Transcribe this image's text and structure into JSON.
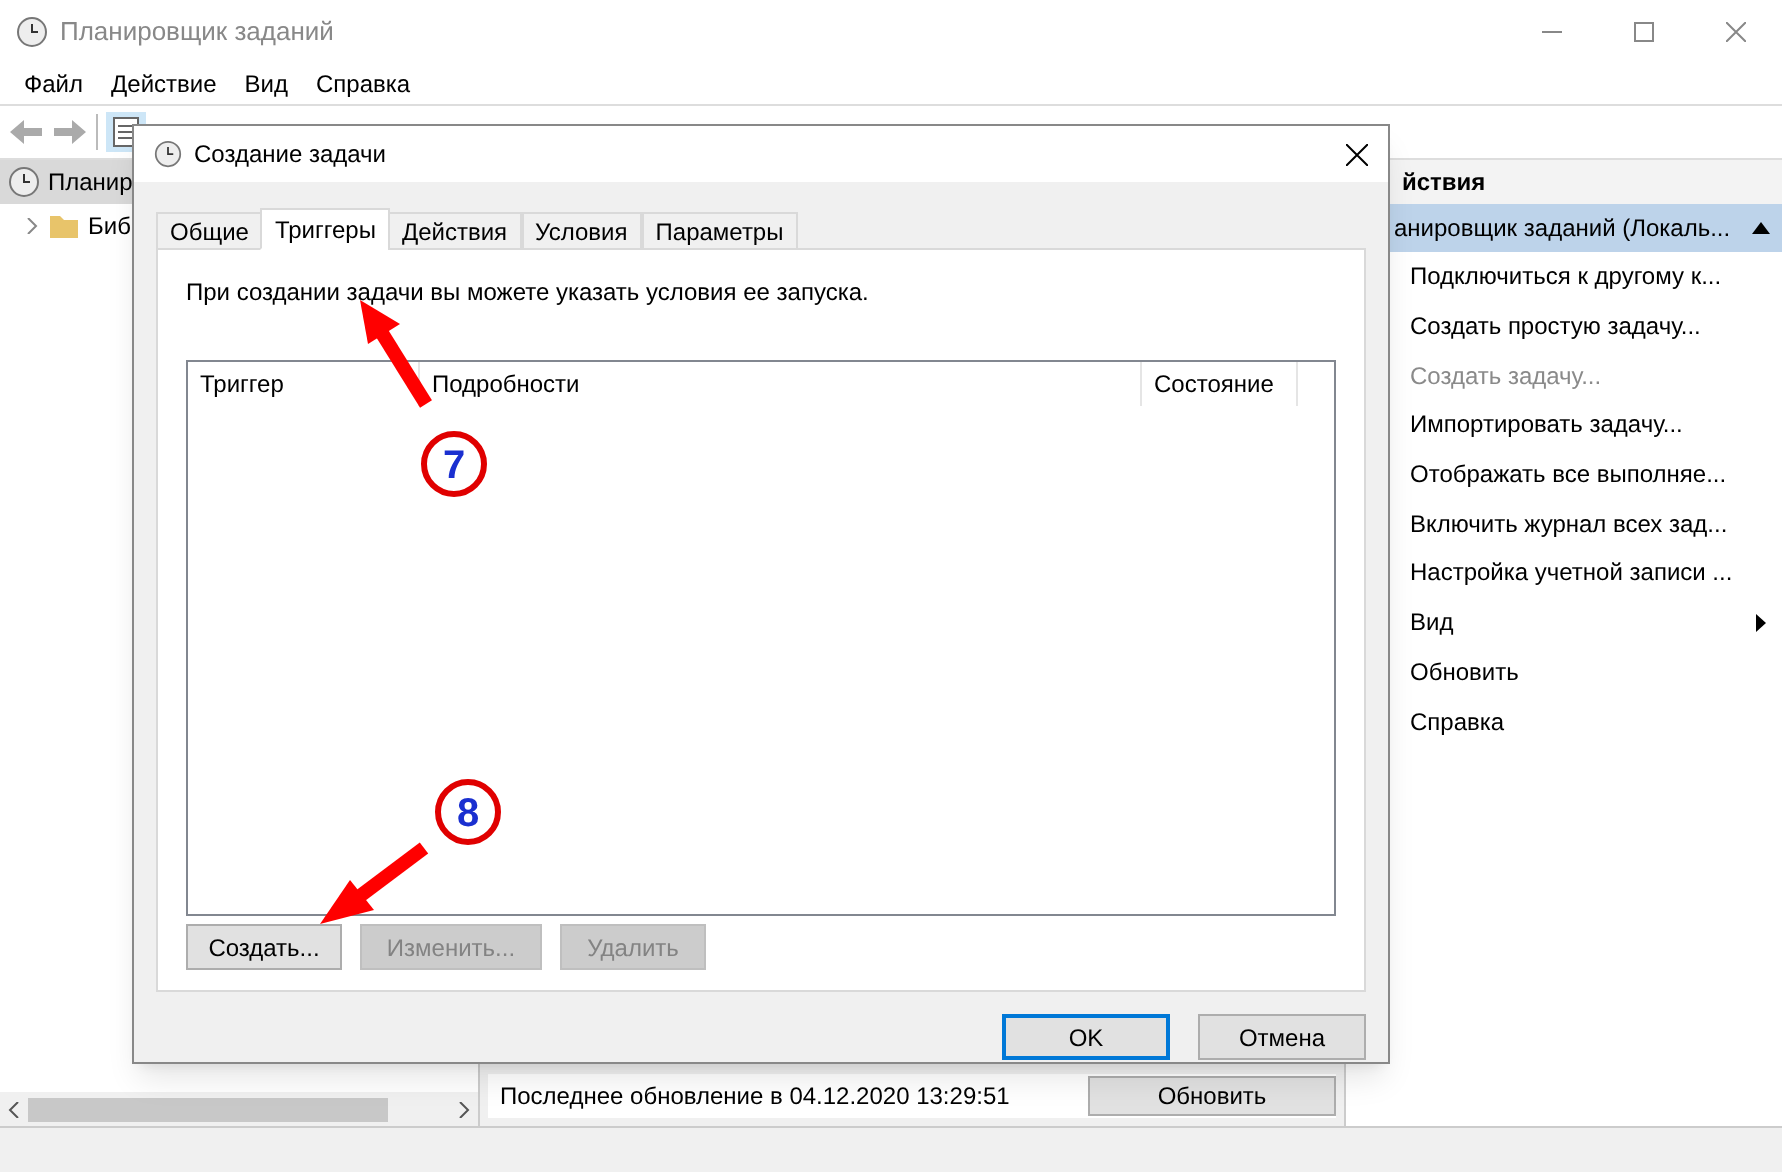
{
  "window": {
    "title": "Планировщик заданий"
  },
  "menu": [
    "Файл",
    "Действие",
    "Вид",
    "Справка"
  ],
  "tree": [
    {
      "label": "Планир",
      "selected": true,
      "children": [
        {
          "label": "Биб",
          "selected": false,
          "expanded": false
        }
      ]
    }
  ],
  "center": {
    "last_update": "Последнее обновление в 04.12.2020 13:29:51",
    "refresh_button": "Обновить"
  },
  "actions_panel": {
    "header": "йствия",
    "group": "анировщик заданий (Локаль...",
    "items": [
      {
        "label": "Подключиться к другому к...",
        "disabled": false,
        "kind": "plain"
      },
      {
        "label": "Создать простую задачу...",
        "disabled": false,
        "kind": "plain"
      },
      {
        "label": "Создать задачу...",
        "disabled": true,
        "kind": "plain"
      },
      {
        "label": "Импортировать задачу...",
        "disabled": false,
        "kind": "plain"
      },
      {
        "label": "Отображать все выполняе...",
        "disabled": false,
        "kind": "plain"
      },
      {
        "label": "Включить журнал всех зад...",
        "disabled": false,
        "kind": "plain"
      },
      {
        "label": "Настройка учетной записи ...",
        "disabled": false,
        "kind": "plain"
      },
      {
        "label": "Вид",
        "disabled": false,
        "kind": "submenu"
      },
      {
        "label": "Обновить",
        "disabled": false,
        "kind": "plain"
      },
      {
        "label": "Справка",
        "disabled": false,
        "kind": "plain"
      }
    ]
  },
  "dialog": {
    "title": "Создание задачи",
    "tabs": [
      {
        "label": "Общие",
        "selected": false
      },
      {
        "label": "Триггеры",
        "selected": true
      },
      {
        "label": "Действия",
        "selected": false
      },
      {
        "label": "Условия",
        "selected": false
      },
      {
        "label": "Параметры",
        "selected": false
      }
    ],
    "description": "При создании задачи вы можете указать условия ее запуска.",
    "table": {
      "columns": [
        "Триггер",
        "Подробности",
        "Состояние"
      ]
    },
    "table_buttons": [
      {
        "label": "Создать...",
        "disabled": false
      },
      {
        "label": "Изменить...",
        "disabled": true
      },
      {
        "label": "Удалить",
        "disabled": true
      }
    ],
    "buttons": [
      {
        "label": "OK",
        "default": true
      },
      {
        "label": "Отмена",
        "default": false
      }
    ]
  },
  "annotations": [
    {
      "number": "7"
    },
    {
      "number": "8"
    }
  ]
}
